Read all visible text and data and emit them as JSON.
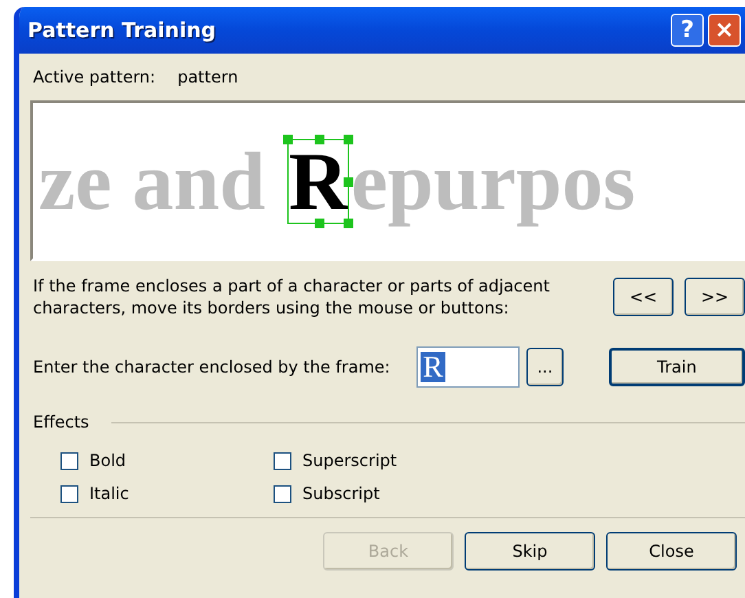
{
  "window": {
    "title": "Pattern Training",
    "title_buttons": [
      {
        "kind": "help",
        "label": "?"
      },
      {
        "kind": "close",
        "label": "×"
      }
    ]
  },
  "active_pattern": {
    "label": "Active pattern:",
    "value": "pattern"
  },
  "preview": {
    "segments": [
      {
        "text": "ze and ",
        "framed": false
      },
      {
        "text": "R",
        "framed": true
      },
      {
        "text": "epurpos",
        "framed": false
      }
    ]
  },
  "instructions": "If the frame encloses a part of a character or parts of adjacent characters, move its borders using the mouse or buttons:",
  "nav_buttons": [
    "<<",
    ">>"
  ],
  "character": {
    "label": "Enter the character enclosed by the frame:",
    "value": "R",
    "browse": "...",
    "train": "Train"
  },
  "effects": {
    "title": "Effects",
    "options": [
      {
        "label": "Bold",
        "checked": false
      },
      {
        "label": "Superscript",
        "checked": false
      },
      {
        "label": "Italic",
        "checked": false
      },
      {
        "label": "Subscript",
        "checked": false
      }
    ]
  },
  "buttons": [
    {
      "label": "Back",
      "disabled": true
    },
    {
      "label": "Skip",
      "disabled": false
    },
    {
      "label": "Close",
      "disabled": false
    }
  ]
}
